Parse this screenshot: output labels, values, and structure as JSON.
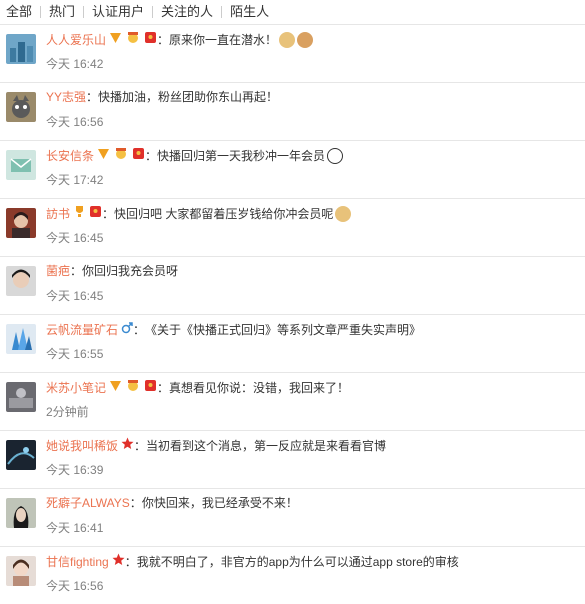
{
  "tabs": [
    "全部",
    "热门",
    "认证用户",
    "关注的人",
    "陌生人"
  ],
  "comments": [
    {
      "name": "人人爱乐山",
      "colon": "：",
      "text": "原来你一直在潜水！",
      "time": "今天 16:42"
    },
    {
      "name": "YY志强",
      "colon": "：",
      "text": "快播加油，粉丝团助你东山再起！",
      "time": "今天 16:56"
    },
    {
      "name": "长安信条",
      "colon": "：",
      "text": "快播回归第一天我秒冲一年会员",
      "time": "今天 17:42"
    },
    {
      "name": "訪书",
      "colon": "：",
      "text": "快回归吧 大家都留着压岁钱给你冲会员呢",
      "time": "今天 16:45"
    },
    {
      "name": "菌疤",
      "colon": "：",
      "text": "你回归我充会员呀",
      "time": "今天 16:45"
    },
    {
      "name": "云帆流量矿石",
      "colon": "：",
      "text": "《关于《快播正式回归》等系列文章严重失实声明》",
      "time": "今天 16:55"
    },
    {
      "name": "米苏小笔记",
      "colon": "：",
      "text": "真想看见你说：没错，我回来了！",
      "time": "2分钟前"
    },
    {
      "name": "她说我叫稀饭",
      "colon": "：",
      "text": "当初看到这个消息，第一反应就是来看看官博",
      "time": "今天 16:39"
    },
    {
      "name": "死癖子ALWAYS",
      "colon": "：",
      "text": "你快回来，我已经承受不来！",
      "time": "今天 16:41"
    },
    {
      "name": "甘信fighting",
      "colon": "：",
      "text": "我就不明白了，非官方的app为什么可以通过app store的审核",
      "time": "今天 16:56"
    }
  ],
  "colors": {
    "name": "#eb7350",
    "time": "#808080",
    "text": "#333333",
    "vip": "#f0a020",
    "star": "#e0302a"
  }
}
